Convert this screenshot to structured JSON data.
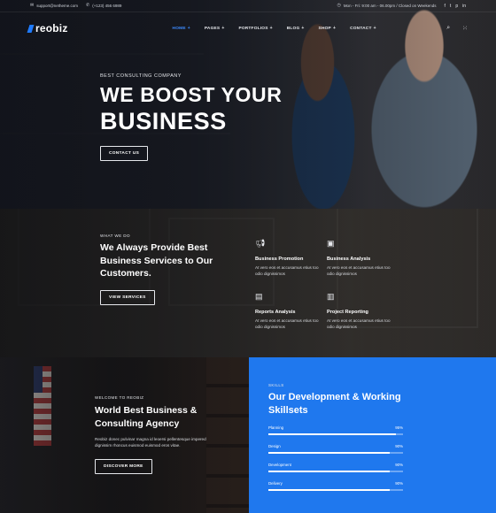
{
  "topbar": {
    "email": "support@netheme.com",
    "phone": "(+123) 456 6989",
    "hours": "Mon - Fri: 9:00 am - 06.00pm / Closed on Weekends",
    "social": [
      {
        "icon": "facebook-icon",
        "glyph": "f"
      },
      {
        "icon": "twitter-icon",
        "glyph": "t"
      },
      {
        "icon": "pinterest-icon",
        "glyph": "p"
      },
      {
        "icon": "linkedin-icon",
        "glyph": "in"
      }
    ]
  },
  "brand": {
    "logo": "reobiz",
    "accent": "#1f7bff"
  },
  "nav": {
    "items": [
      {
        "label": "HOME",
        "active": true
      },
      {
        "label": "PAGES",
        "active": false
      },
      {
        "label": "PORTFOLIOS",
        "active": false
      },
      {
        "label": "BLOG",
        "active": false
      },
      {
        "label": "SHOP",
        "active": false
      },
      {
        "label": "CONTACT",
        "active": false
      }
    ],
    "plus": "+"
  },
  "hero": {
    "eyebrow": "BEST CONSULTING COMPANY",
    "line1": "WE BOOST YOUR",
    "line2": "BUSINESS",
    "button": "CONTACT US"
  },
  "services": {
    "eyebrow": "WHAT WE DO",
    "heading": "We Always Provide Best Business Services to Our Customers.",
    "button": "VIEW SERVICES",
    "cards": [
      {
        "icon": "megaphone-icon",
        "title": "Business Promotion",
        "text": "At vero eos et accusamus etius too odio dignissimos"
      },
      {
        "icon": "briefcase-icon",
        "title": "Business Analysis",
        "text": "At vero eos et accusamus etius too odio dignissimos"
      },
      {
        "icon": "document-icon",
        "title": "Reports Analysis",
        "text": "At vero eos et accusamus etius too odio dignissimos"
      },
      {
        "icon": "report-icon",
        "title": "Project Reporting",
        "text": "At vero eos et accusamus etius too odio dignissimos"
      }
    ]
  },
  "about": {
    "eyebrow": "WELCOME TO REOBIZ",
    "heading": "World Best Business & Consulting Agency",
    "text": "Reobiz donec pulvinar magna id leoersi pellentesque impered dignissim rhoncus euismod euismod eros vitae.",
    "button": "DISCOVER MORE"
  },
  "skills": {
    "eyebrow": "SKILLS",
    "heading": "Our Development & Working Skillsets",
    "color": "#1f78ee",
    "items": [
      {
        "name": "Planning",
        "percent": 95,
        "label": "95%"
      },
      {
        "name": "Design",
        "percent": 90,
        "label": "90%"
      },
      {
        "name": "Development",
        "percent": 90,
        "label": "90%"
      },
      {
        "name": "Delivery",
        "percent": 90,
        "label": "90%"
      }
    ]
  }
}
